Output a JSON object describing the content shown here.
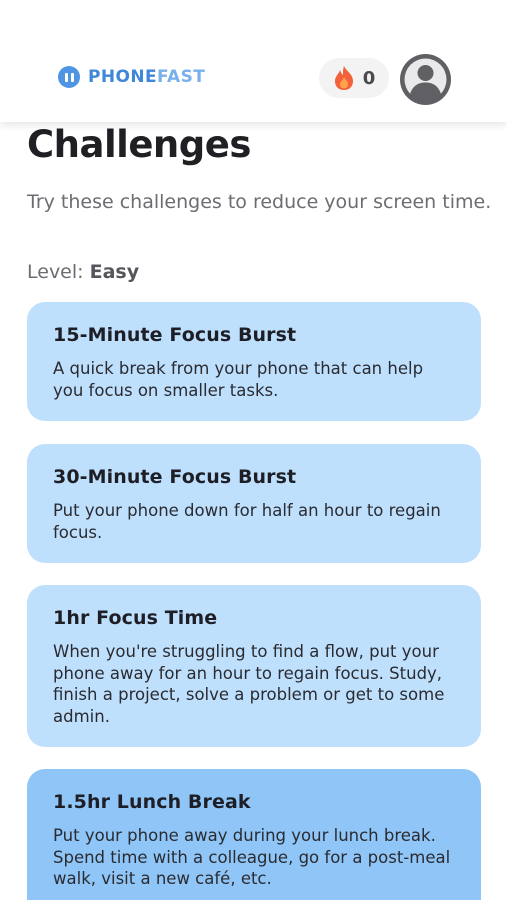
{
  "header": {
    "brand_part1": "PHONE",
    "brand_part2": "FAST",
    "streak_count": "0",
    "icons": {
      "logo": "pause-circle-icon",
      "streak": "fire-icon",
      "avatar": "user-avatar-icon"
    }
  },
  "main": {
    "title": "Challenges",
    "subtitle": "Try these challenges to reduce your screen time.",
    "level_label": "Level:",
    "level_value": "Easy"
  },
  "challenges": [
    {
      "title": "15-Minute Focus Burst",
      "description": "A quick break from your phone that can help you focus on smaller tasks."
    },
    {
      "title": "30-Minute Focus Burst",
      "description": "Put your phone down for half an hour to regain focus."
    },
    {
      "title": "1hr Focus Time",
      "description": "When you're struggling to find a flow, put your phone away for an hour to regain focus. Study, finish a project, solve a problem or get to some admin."
    },
    {
      "title": "1.5hr Lunch Break",
      "description": "Put your phone away during your lunch break. Spend time with a colleague, go for a post-meal walk, visit a new café, etc."
    }
  ],
  "colors": {
    "brand_primary": "#3f87d9",
    "brand_secondary": "#79b0ec",
    "card_background": "#bfe0fd",
    "card_selected_background": "#8fc6f7",
    "flame": "#f2603c"
  }
}
